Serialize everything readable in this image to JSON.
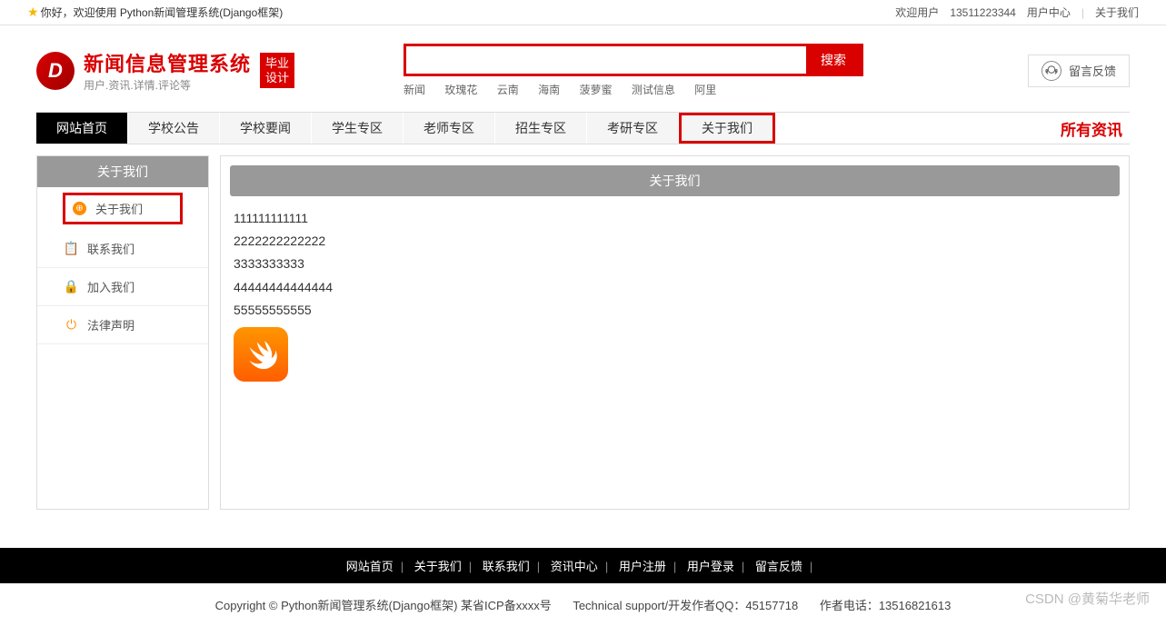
{
  "topbar": {
    "greeting": "你好，欢迎使用 Python新闻管理系统(Django框架)",
    "welcome_user": "欢迎用户",
    "phone": "13511223344",
    "user_center": "用户中心",
    "about_us": "关于我们"
  },
  "header": {
    "logo_title": "新闻信息管理系统",
    "logo_sub": "用户.资讯.详情.评论等",
    "badge_line1": "毕业",
    "badge_line2": "设计",
    "search_btn": "搜索",
    "tags": [
      "新闻",
      "玫瑰花",
      "云南",
      "海南",
      "菠萝蜜",
      "测试信息",
      "阿里"
    ],
    "feedback": "留言反馈"
  },
  "nav": {
    "items": [
      "网站首页",
      "学校公告",
      "学校要闻",
      "学生专区",
      "老师专区",
      "招生专区",
      "考研专区",
      "关于我们"
    ],
    "right": "所有资讯"
  },
  "sidebar": {
    "title": "关于我们",
    "items": [
      {
        "label": "关于我们",
        "icon": "globe"
      },
      {
        "label": "联系我们",
        "icon": "doc"
      },
      {
        "label": "加入我们",
        "icon": "lock"
      },
      {
        "label": "法律声明",
        "icon": "power"
      }
    ]
  },
  "main": {
    "title": "关于我们",
    "lines": [
      "111111111111",
      "2222222222222",
      "3333333333",
      "44444444444444",
      "55555555555"
    ]
  },
  "footer": {
    "links": [
      "网站首页",
      "关于我们",
      "联系我们",
      "资讯中心",
      "用户注册",
      "用户登录",
      "留言反馈"
    ],
    "copyright": "Copyright © Python新闻管理系统(Django框架) 某省ICP备xxxx号",
    "tech": "Technical support/开发作者QQ：45157718",
    "author_phone": "作者电话：13516821613"
  },
  "watermark": "CSDN @黄菊华老师"
}
